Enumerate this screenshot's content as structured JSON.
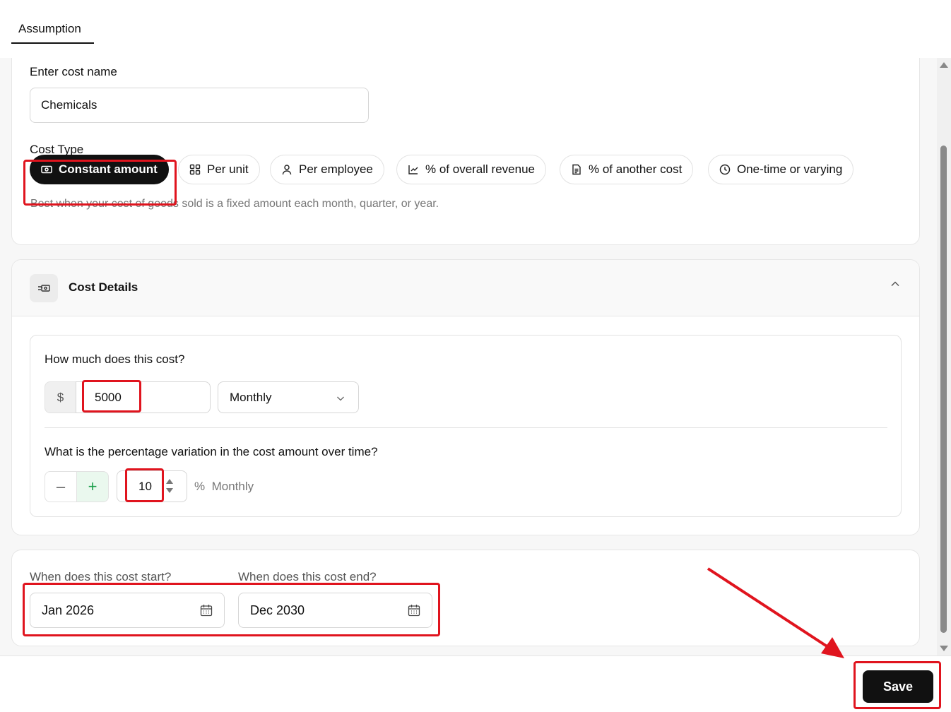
{
  "tabs": [
    {
      "label": "Assumption"
    }
  ],
  "cost_name": {
    "label": "Enter cost name",
    "value": "Chemicals"
  },
  "cost_type": {
    "label": "Cost Type",
    "options": [
      {
        "label": "Constant amount",
        "icon": "banknote-icon",
        "selected": true
      },
      {
        "label": "Per unit",
        "icon": "grid-icon",
        "selected": false
      },
      {
        "label": "Per employee",
        "icon": "user-icon",
        "selected": false
      },
      {
        "label": "% of overall revenue",
        "icon": "chart-line-icon",
        "selected": false
      },
      {
        "label": "% of another cost",
        "icon": "document-icon",
        "selected": false
      },
      {
        "label": "One-time or varying",
        "icon": "clock-icon",
        "selected": false
      }
    ],
    "hint": "Best when your cost of goods sold is a fixed amount each month, quarter, or year."
  },
  "cost_details": {
    "title": "Cost Details",
    "amount_question": "How much does this cost?",
    "currency": "$",
    "amount": "5000",
    "frequency": "Monthly",
    "variation_question": "What is the percentage variation in the cost amount over time?",
    "variation_value": "10",
    "variation_unit": "%",
    "variation_period": "Monthly"
  },
  "dates": {
    "start_label": "When does this cost start?",
    "start_value": "Jan 2026",
    "end_label": "When does this cost end?",
    "end_value": "Dec 2030"
  },
  "footer": {
    "save_label": "Save"
  },
  "colors": {
    "accent": "#111111",
    "highlight": "#e0141e",
    "plus_green": "#1a9e4a"
  }
}
